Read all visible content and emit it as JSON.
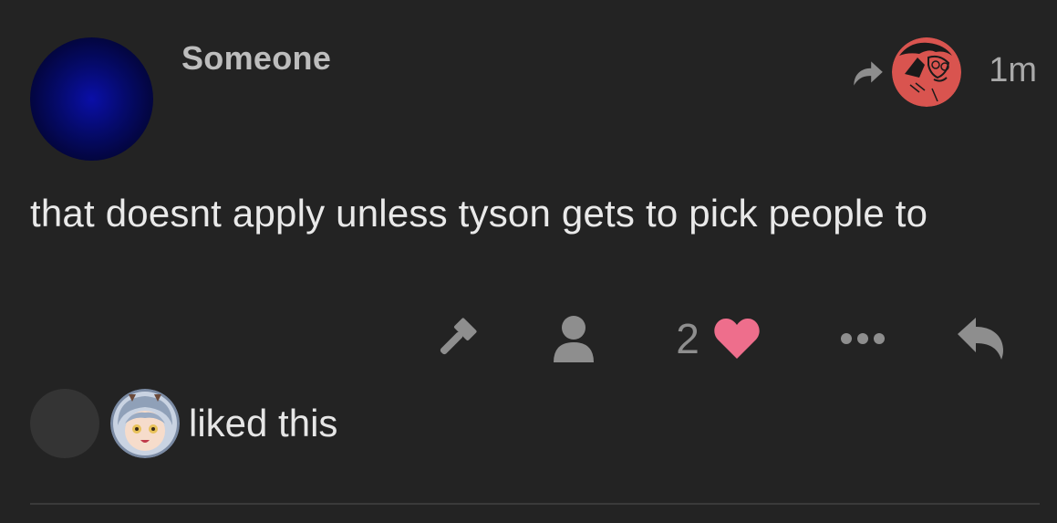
{
  "post": {
    "username": "Someone",
    "time": "1m",
    "content": "that doesnt apply unless tyson gets to pick people to",
    "like_count": "2",
    "liked_text": "liked this"
  },
  "colors": {
    "background": "#232323",
    "heart": "#ee6e8c",
    "icon_gray": "#8e8e8e",
    "reply_avatar": "#d9544f"
  },
  "icons": {
    "share": "share-arrow-icon",
    "flag": "gavel-icon",
    "user": "user-icon",
    "like": "heart-icon",
    "more": "ellipsis-icon",
    "reply": "reply-arrow-icon"
  }
}
